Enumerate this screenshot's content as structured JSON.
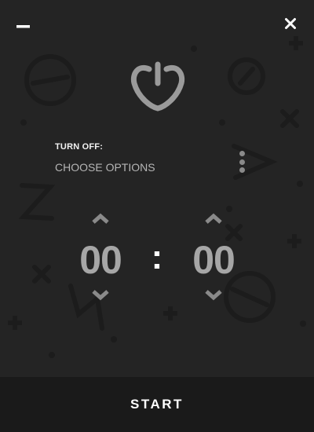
{
  "window": {
    "minimize_icon": "minimize-icon",
    "close_icon": "close-icon"
  },
  "logo": {
    "icon": "power-heart-icon"
  },
  "shutdown": {
    "label": "TURN OFF:",
    "option_text": "CHOOSE OPTIONS",
    "menu_icon": "kebab-menu-icon"
  },
  "timer": {
    "hours": "00",
    "separator": ":",
    "minutes": "00"
  },
  "footer": {
    "start_label": "START"
  },
  "colors": {
    "background": "#242424",
    "footer": "#1a1a1a",
    "digits": "#a6a6a6",
    "accent": "#ffffff"
  }
}
